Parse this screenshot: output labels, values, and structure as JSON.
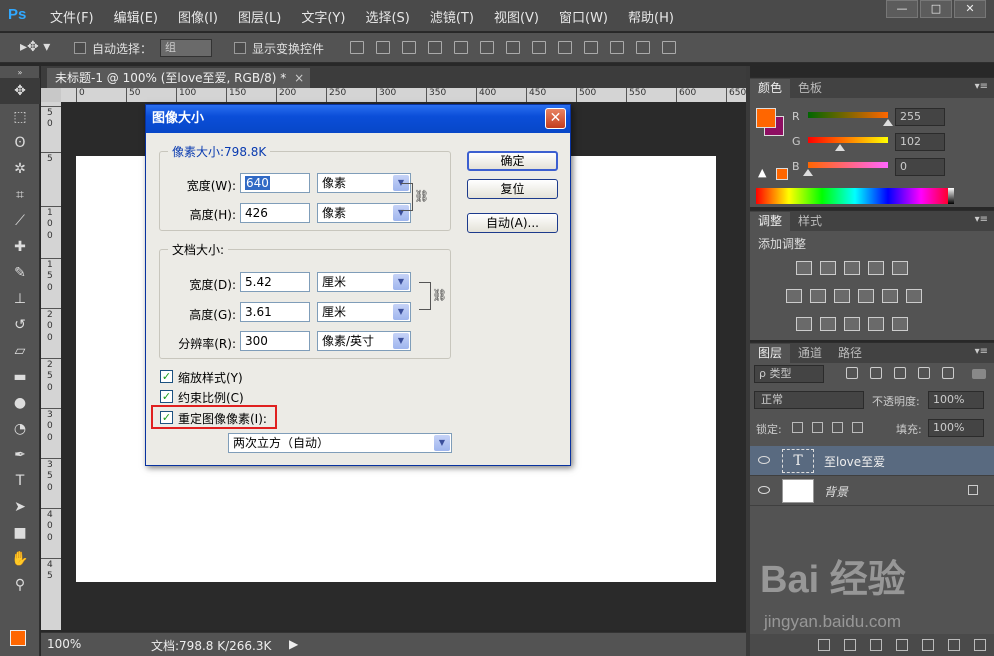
{
  "app": {
    "logo": "Ps"
  },
  "menu": [
    "文件(F)",
    "编辑(E)",
    "图像(I)",
    "图层(L)",
    "文字(Y)",
    "选择(S)",
    "滤镜(T)",
    "视图(V)",
    "窗口(W)",
    "帮助(H)"
  ],
  "window_buttons": [
    "—",
    "□",
    "✕"
  ],
  "options": {
    "auto_select_label": "自动选择：",
    "auto_select_value": "组",
    "show_transform_label": "显示变换控件"
  },
  "document": {
    "tab_title": "未标题-1 @ 100% (至love至爱, RGB/8) *",
    "tab_close": "×",
    "ruler_h": [
      "0",
      "50",
      "100",
      "150",
      "200",
      "250",
      "300",
      "350",
      "400",
      "450",
      "500",
      "550",
      "600",
      "650"
    ],
    "ruler_v": [
      "5",
      "0",
      "5",
      "0",
      "1",
      "0",
      "0",
      "1",
      "5",
      "0",
      "2",
      "0",
      "0",
      "2",
      "5",
      "0",
      "3",
      "0",
      "0",
      "3",
      "5",
      "0",
      "4",
      "0",
      "0",
      "4",
      "5"
    ]
  },
  "status": {
    "zoom": "100%",
    "doc_info": "文档:798.8 K/266.3K",
    "arrow": "▶"
  },
  "color_panel": {
    "tabs": [
      "颜色",
      "色板"
    ],
    "channels": [
      {
        "label": "R",
        "value": "255"
      },
      {
        "label": "G",
        "value": "102"
      },
      {
        "label": "B",
        "value": "0"
      }
    ],
    "warn_icon": "▲"
  },
  "adjustments_panel": {
    "tabs": [
      "调整",
      "样式"
    ],
    "title": "添加调整"
  },
  "layers_panel": {
    "tabs": [
      "图层",
      "通道",
      "路径"
    ],
    "filter_label": "ρ 类型",
    "blend_mode": "正常",
    "opacity_label": "不透明度:",
    "opacity_value": "100%",
    "lock_label": "锁定:",
    "fill_label": "填充:",
    "fill_value": "100%",
    "layers": [
      {
        "name": "至love至爱",
        "thumb": "T",
        "selected": true
      },
      {
        "name": "背景",
        "thumb": "",
        "selected": false
      }
    ]
  },
  "watermark": {
    "main": "Bai 经验",
    "sub": "jingyan.baidu.com"
  },
  "dialog": {
    "title": "图像大小",
    "close": "✕",
    "pixel_group_title": "像素大小:798.8K",
    "pixel_width_label": "宽度(W):",
    "pixel_width_value": "640",
    "pixel_width_unit": "像素",
    "pixel_height_label": "高度(H):",
    "pixel_height_value": "426",
    "pixel_height_unit": "像素",
    "doc_group_title": "文档大小:",
    "doc_width_label": "宽度(D):",
    "doc_width_value": "5.42",
    "doc_width_unit": "厘米",
    "doc_height_label": "高度(G):",
    "doc_height_value": "3.61",
    "doc_height_unit": "厘米",
    "resolution_label": "分辨率(R):",
    "resolution_value": "300",
    "resolution_unit": "像素/英寸",
    "ok_button": "确定",
    "reset_button": "复位",
    "auto_button": "自动(A)...",
    "scale_styles_label": "缩放样式(Y)",
    "constrain_label": "约束比例(C)",
    "resample_label": "重定图像像素(I):",
    "interpolation": "两次立方（自动）",
    "check_mark": "✓",
    "dropdown_arrow": "▼"
  }
}
